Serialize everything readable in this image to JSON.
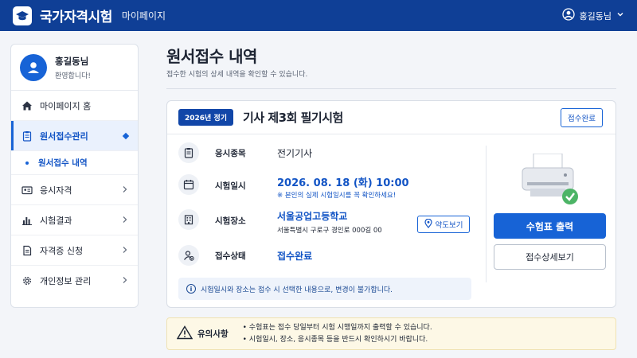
{
  "header": {
    "app_title": "국가자격시험",
    "app_subtitle": "마이페이지",
    "user_name": "홍길동님",
    "brand_color": "#0f3f96"
  },
  "sidebar": {
    "profile": {
      "name": "홍길동님",
      "greeting": "환영합니다!"
    },
    "items": [
      {
        "label": "마이페이지 홈",
        "icon": "home-icon"
      },
      {
        "label": "원서접수관리",
        "icon": "clipboard-icon",
        "active": true
      },
      {
        "label": "원서접수 내역",
        "sub": true
      },
      {
        "label": "응시자격",
        "icon": "id-card-icon"
      },
      {
        "label": "시험결과",
        "icon": "bar-chart-icon"
      },
      {
        "label": "자격증 신청",
        "icon": "document-icon"
      },
      {
        "label": "개인정보 관리",
        "icon": "gear-icon"
      }
    ]
  },
  "main": {
    "title": "원서접수 내역",
    "description": "접수한 시험의 상세 내역을 확인할 수 있습니다."
  },
  "card": {
    "badge": "2026년 정기",
    "exam_title": "기사 제3회 필기시험",
    "status_label": "접수완료",
    "rows": {
      "category": {
        "label": "응시종목",
        "value": "전기기사"
      },
      "date": {
        "label": "시험일시",
        "value": "2026. 08. 18 (화) 10:00",
        "note": "※ 본인의 실제 시험일시를 꼭 확인하세요!"
      },
      "place": {
        "label": "시험장소",
        "value": "서울공업고등학교",
        "address": "서울특별시 구로구 경인로 000길 00",
        "map_button": "약도보기"
      },
      "status": {
        "label": "접수상태",
        "value": "접수완료"
      }
    },
    "notice": "시험일시와 장소는 접수 시 선택한 내용으로, 변경이 불가합니다.",
    "print_button": "수험표 출력",
    "detail_button": "접수상세보기"
  },
  "caution": {
    "label": "유의사항",
    "items": [
      "• 수험표는 접수 당일부터 시험 시행일까지 출력할 수 있습니다.",
      "• 시험일시, 장소, 응시종목 등을 반드시 확인하시기 바랍니다."
    ]
  },
  "colors": {
    "accent": "#1763d6",
    "accent_dark": "#1254c5"
  }
}
